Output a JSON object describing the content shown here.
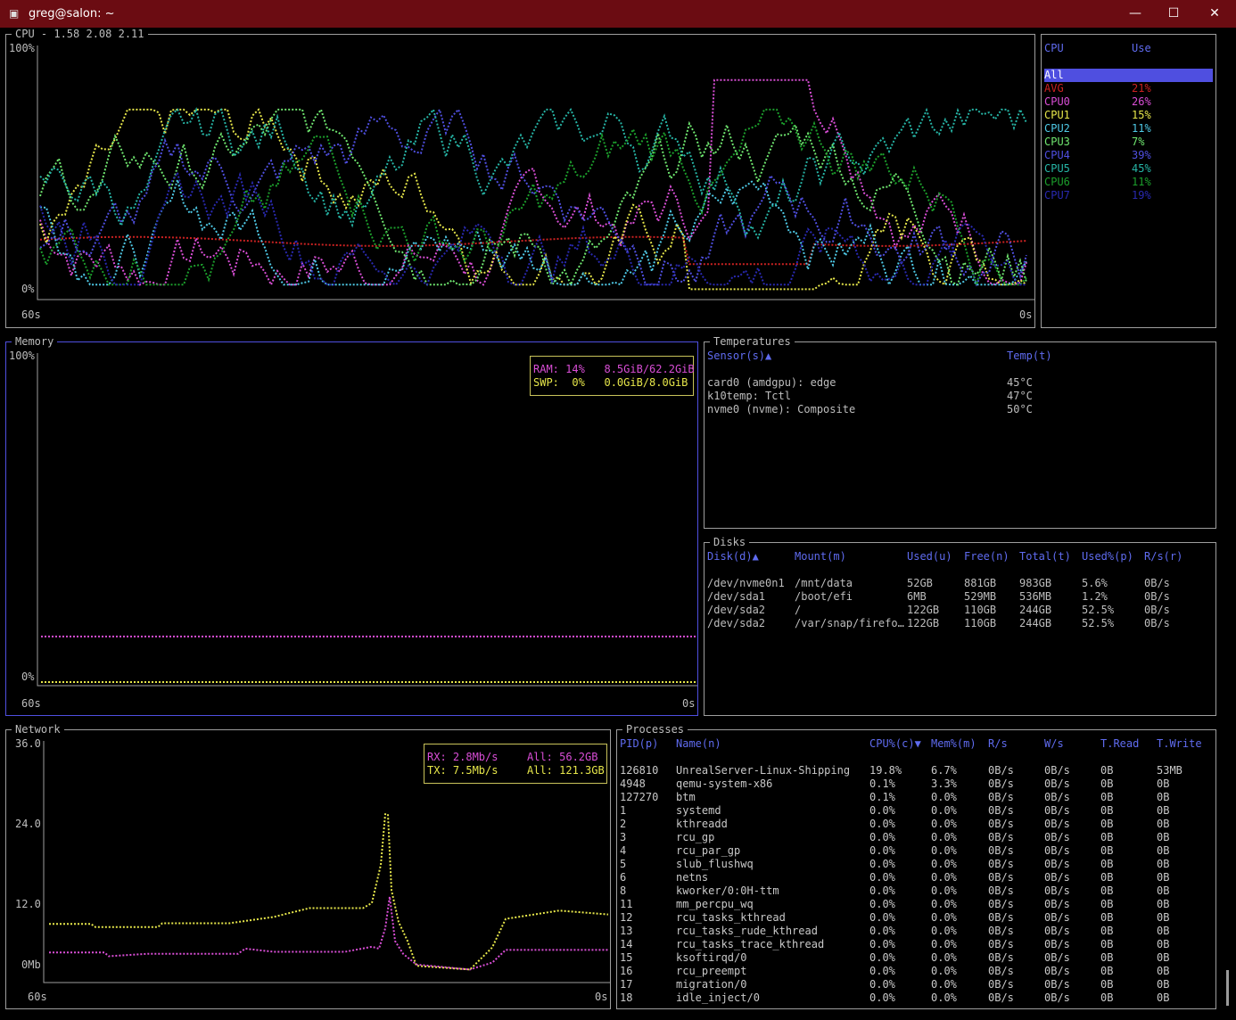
{
  "window": {
    "title": "greg@salon: ~",
    "min": "—",
    "max": "☐",
    "close": "✕"
  },
  "colors": {
    "titlebar": "#6b0c12",
    "header": "#5f6bef",
    "avg": "#cc2222",
    "ram": "#d94ed6",
    "swap": "#e6e64a",
    "rx": "#d94ed6",
    "tx": "#e6e64a"
  },
  "cpu": {
    "title": "CPU - 1.58 2.08 2.11",
    "y_top": "100%",
    "y_bottom": "0%",
    "x_left": "60s",
    "x_right": "0s",
    "table": {
      "col_cpu": "CPU",
      "col_use": "Use",
      "rows": [
        {
          "name": "All",
          "use": "",
          "color": "#ffffff"
        },
        {
          "name": "AVG",
          "use": "21%",
          "color": "#cc2222"
        },
        {
          "name": "CPU0",
          "use": "26%",
          "color": "#d94ed6"
        },
        {
          "name": "CPU1",
          "use": "15%",
          "color": "#e6e64a"
        },
        {
          "name": "CPU2",
          "use": "11%",
          "color": "#4ec9e6"
        },
        {
          "name": "CPU3",
          "use": "7%",
          "color": "#6fe66f"
        },
        {
          "name": "CPU4",
          "use": "39%",
          "color": "#4f4fe0"
        },
        {
          "name": "CPU5",
          "use": "45%",
          "color": "#26b5a6"
        },
        {
          "name": "CPU6",
          "use": "11%",
          "color": "#1c9f2c"
        },
        {
          "name": "CPU7",
          "use": "19%",
          "color": "#2929b0"
        }
      ]
    }
  },
  "memory": {
    "title": "Memory",
    "y_top": "100%",
    "y_bottom": "0%",
    "x_left": "60s",
    "x_right": "0s",
    "ram_label": "RAM: 14%   8.5GiB/62.2GiB",
    "swp_label": "SWP:  0%   0.0GiB/8.0GiB",
    "ram_pct": 14,
    "swp_pct": 0
  },
  "temperatures": {
    "title": "Temperatures",
    "col_sensor": "Sensor(s)▲",
    "col_temp": "Temp(t)",
    "rows": [
      {
        "sensor": "card0 (amdgpu): edge",
        "temp": "45°C"
      },
      {
        "sensor": "k10temp: Tctl",
        "temp": "47°C"
      },
      {
        "sensor": "nvme0 (nvme): Composite",
        "temp": "50°C"
      }
    ]
  },
  "disks": {
    "title": "Disks",
    "headers": [
      "Disk(d)▲",
      "Mount(m)",
      "Used(u)",
      "Free(n)",
      "Total(t)",
      "Used%(p)",
      "R/s(r)"
    ],
    "rows": [
      [
        "/dev/nvme0n1",
        "/mnt/data",
        "52GB",
        "881GB",
        "983GB",
        "5.6%",
        "0B/s"
      ],
      [
        "/dev/sda1",
        "/boot/efi",
        "6MB",
        "529MB",
        "536MB",
        "1.2%",
        "0B/s"
      ],
      [
        "/dev/sda2",
        "/",
        "122GB",
        "110GB",
        "244GB",
        "52.5%",
        "0B/s"
      ],
      [
        "/dev/sda2",
        "/var/snap/firefo…",
        "122GB",
        "110GB",
        "244GB",
        "52.5%",
        "0B/s"
      ]
    ]
  },
  "network": {
    "title": "Network",
    "y_ticks": [
      "36.0",
      "24.0",
      "12.0",
      "0Mb"
    ],
    "x_left": "60s",
    "x_right": "0s",
    "rx_label": "RX: 2.8Mb/s",
    "rx_all": "All: 56.2GB",
    "tx_label": "TX: 7.5Mb/s",
    "tx_all": "All: 121.3GB"
  },
  "processes": {
    "title": "Processes",
    "headers": [
      "PID(p)",
      "Name(n)",
      "CPU%(c)▼",
      "Mem%(m)",
      "R/s",
      "W/s",
      "T.Read",
      "T.Write"
    ],
    "rows": [
      [
        "126810",
        "UnrealServer-Linux-Shipping",
        "19.8%",
        "6.7%",
        "0B/s",
        "0B/s",
        "0B",
        "53MB"
      ],
      [
        "4948",
        "qemu-system-x86",
        "0.1%",
        "3.3%",
        "0B/s",
        "0B/s",
        "0B",
        "0B"
      ],
      [
        "127270",
        "btm",
        "0.1%",
        "0.0%",
        "0B/s",
        "0B/s",
        "0B",
        "0B"
      ],
      [
        "1",
        "systemd",
        "0.0%",
        "0.0%",
        "0B/s",
        "0B/s",
        "0B",
        "0B"
      ],
      [
        "2",
        "kthreadd",
        "0.0%",
        "0.0%",
        "0B/s",
        "0B/s",
        "0B",
        "0B"
      ],
      [
        "3",
        "rcu_gp",
        "0.0%",
        "0.0%",
        "0B/s",
        "0B/s",
        "0B",
        "0B"
      ],
      [
        "4",
        "rcu_par_gp",
        "0.0%",
        "0.0%",
        "0B/s",
        "0B/s",
        "0B",
        "0B"
      ],
      [
        "5",
        "slub_flushwq",
        "0.0%",
        "0.0%",
        "0B/s",
        "0B/s",
        "0B",
        "0B"
      ],
      [
        "6",
        "netns",
        "0.0%",
        "0.0%",
        "0B/s",
        "0B/s",
        "0B",
        "0B"
      ],
      [
        "8",
        "kworker/0:0H-ttm",
        "0.0%",
        "0.0%",
        "0B/s",
        "0B/s",
        "0B",
        "0B"
      ],
      [
        "11",
        "mm_percpu_wq",
        "0.0%",
        "0.0%",
        "0B/s",
        "0B/s",
        "0B",
        "0B"
      ],
      [
        "12",
        "rcu_tasks_kthread",
        "0.0%",
        "0.0%",
        "0B/s",
        "0B/s",
        "0B",
        "0B"
      ],
      [
        "13",
        "rcu_tasks_rude_kthread",
        "0.0%",
        "0.0%",
        "0B/s",
        "0B/s",
        "0B",
        "0B"
      ],
      [
        "14",
        "rcu_tasks_trace_kthread",
        "0.0%",
        "0.0%",
        "0B/s",
        "0B/s",
        "0B",
        "0B"
      ],
      [
        "15",
        "ksoftirqd/0",
        "0.0%",
        "0.0%",
        "0B/s",
        "0B/s",
        "0B",
        "0B"
      ],
      [
        "16",
        "rcu_preempt",
        "0.0%",
        "0.0%",
        "0B/s",
        "0B/s",
        "0B",
        "0B"
      ],
      [
        "17",
        "migration/0",
        "0.0%",
        "0.0%",
        "0B/s",
        "0B/s",
        "0B",
        "0B"
      ],
      [
        "18",
        "idle_inject/0",
        "0.0%",
        "0.0%",
        "0B/s",
        "0B/s",
        "0B",
        "0B"
      ]
    ]
  }
}
